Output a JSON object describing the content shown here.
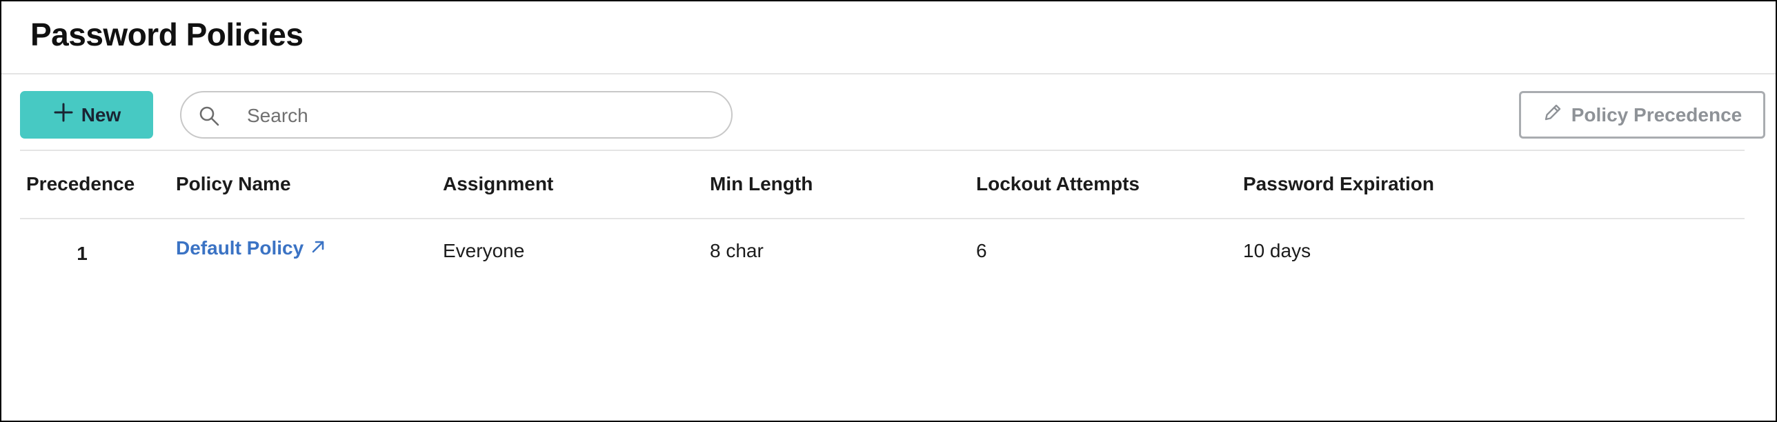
{
  "page": {
    "title": "Password Policies"
  },
  "toolbar": {
    "new_label": "New",
    "search_placeholder": "Search",
    "search_value": "",
    "precedence_label": "Policy Precedence"
  },
  "table": {
    "columns": [
      "Precedence",
      "Policy Name",
      "Assignment",
      "Min Length",
      "Lockout Attempts",
      "Password Expiration"
    ],
    "rows": [
      {
        "precedence": "1",
        "policy_name": "Default Policy",
        "assignment": "Everyone",
        "min_length": "8 char",
        "lockout_attempts": "6",
        "password_expiration": "10 days"
      }
    ]
  },
  "icons": {
    "new": "plus-icon",
    "search": "search-icon",
    "precedence": "pencil-icon",
    "policy_link": "external-link-arrow-icon"
  },
  "colors": {
    "primary_button": "#47c9c3",
    "link": "#3b73c4",
    "disabled_text": "#8e9297"
  }
}
